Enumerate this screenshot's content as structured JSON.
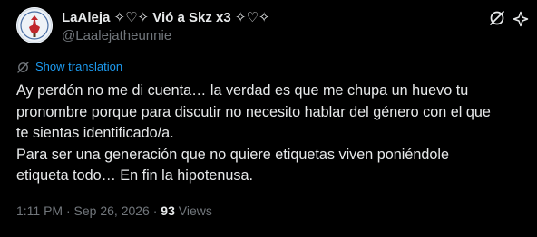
{
  "tweet": {
    "display_name": "LaAleja ✧♡✧ Vió a Skz x3 ✧♡✧",
    "handle": "@Laalejatheunnie",
    "show_translation": "Show translation",
    "lines": [
      "Ay perdón no me di cuenta… la verdad es que me chupa un huevo tu",
      "pronombre porque para discutir no necesito hablar del género con el que",
      "te sientas identificado/a.",
      "Para ser una generación que no quiere etiquetas viven poniéndole",
      "etiqueta todo… En fin la hipotenusa."
    ],
    "timestamp": "1:11 PM · Sep 26, 2026",
    "separator": " · ",
    "views_count": "93",
    "views_label": " Views"
  },
  "icons": {
    "translate": "translate-icon",
    "grok": "grok-icon",
    "more": "more-icon"
  },
  "colors": {
    "background": "#000000",
    "text": "#e7e9ea",
    "secondary": "#71767b",
    "link": "#1d9bf0"
  }
}
